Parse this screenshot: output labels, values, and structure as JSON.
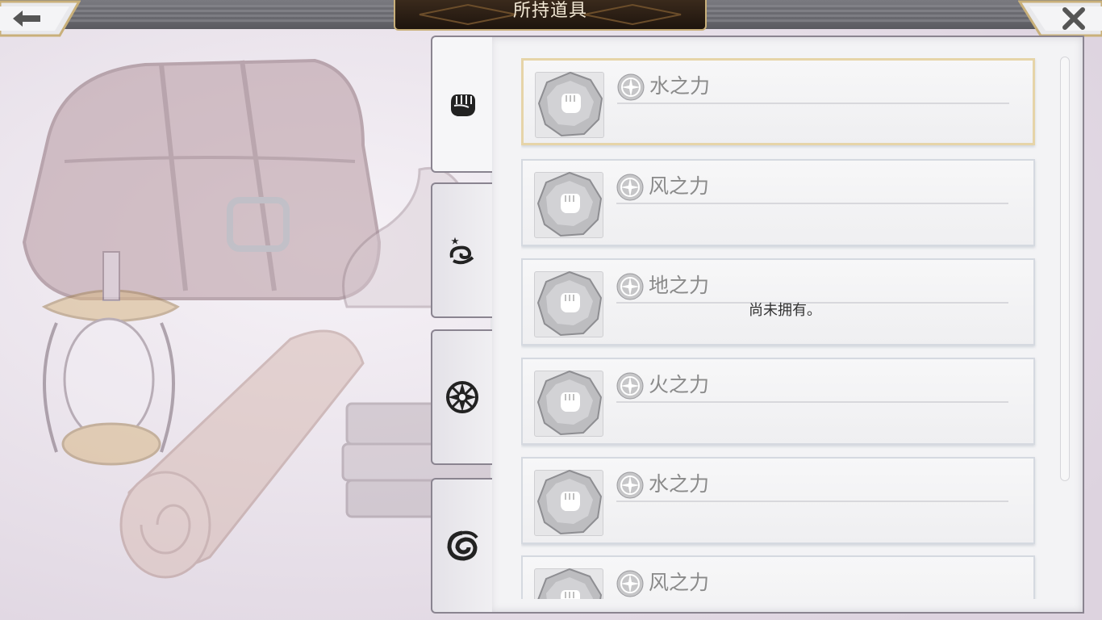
{
  "header": {
    "title": "所持道具",
    "back_icon": "arrow-left-icon",
    "close_icon": "close-icon"
  },
  "tabs": [
    {
      "icon": "fist-icon",
      "active": true
    },
    {
      "icon": "wind-swirl-icon",
      "active": false
    },
    {
      "icon": "compass-star-icon",
      "active": false
    },
    {
      "icon": "vortex-icon",
      "active": false
    }
  ],
  "items": [
    {
      "name": "水之力",
      "selected": true
    },
    {
      "name": "风之力",
      "selected": false
    },
    {
      "name": "地之力",
      "selected": false
    },
    {
      "name": "火之力",
      "selected": false
    },
    {
      "name": "水之力",
      "selected": false
    },
    {
      "name": "风之力",
      "selected": false
    }
  ],
  "empty_message": "尚未拥有。",
  "colors": {
    "title_bg": "#2a1d12",
    "title_border": "#c9b07a",
    "selected_border": "#e6d4a8",
    "item_text": "#8a8a8a"
  }
}
